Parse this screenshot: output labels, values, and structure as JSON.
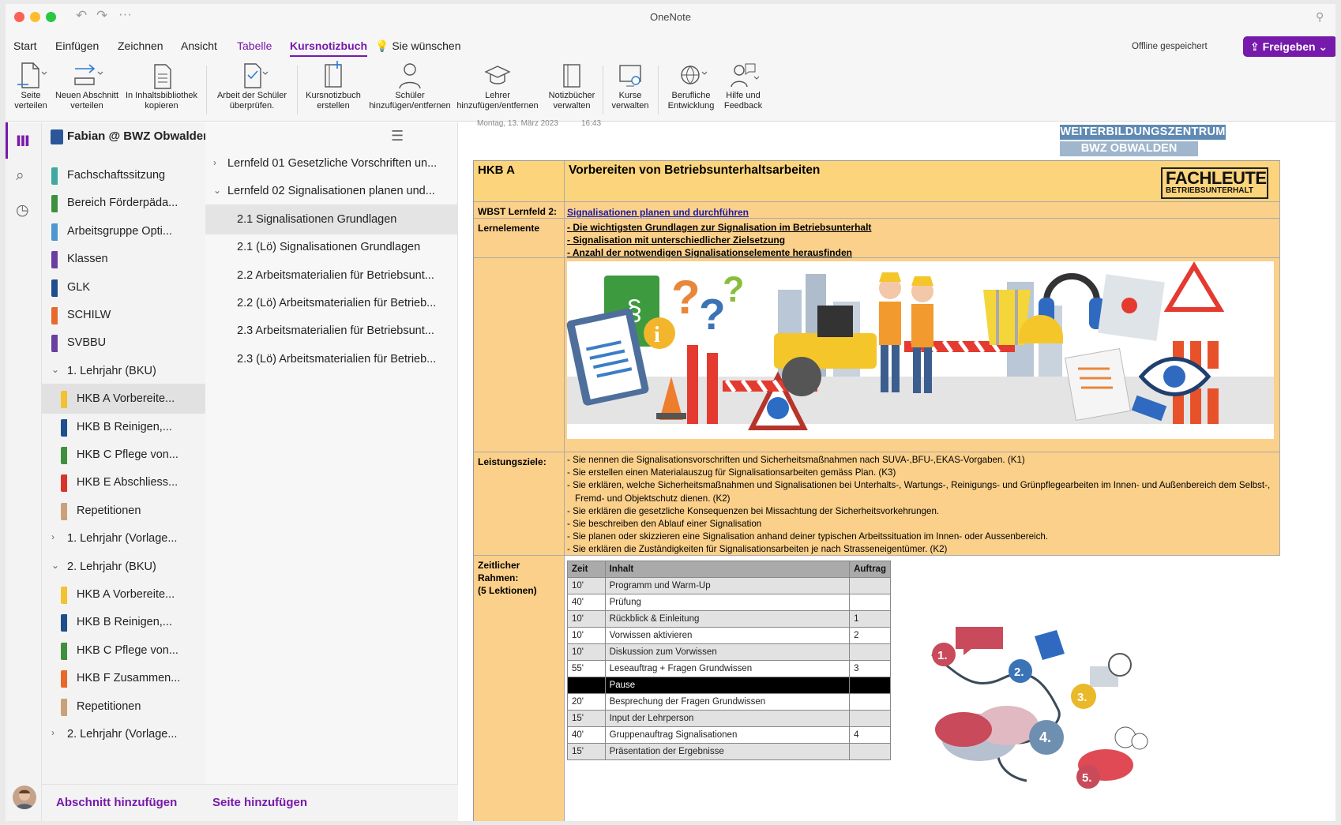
{
  "window": {
    "title": "OneNote"
  },
  "menu": {
    "tabs": [
      "Start",
      "Einfügen",
      "Zeichnen",
      "Ansicht",
      "Tabelle",
      "Kursnotizbuch"
    ],
    "tell_me": "Sie wünschen",
    "status": "Offline gespeichert",
    "share": "Freigeben"
  },
  "ribbon": {
    "buttons": [
      "Seite\nverteilen",
      "Neuen Abschnitt\nverteilen",
      "In Inhaltsbibliothek\nkopieren",
      "Arbeit der Schüler\nüberprüfen.",
      "Kursnotizbuch\nerstellen",
      "Schüler\nhinzufügen/entfernen",
      "Lehrer\nhinzufügen/entfernen",
      "Notizbücher\nverwalten",
      "Kurse\nverwalten",
      "Berufliche\nEntwicklung",
      "Hilfe und\nFeedback"
    ]
  },
  "notebook": {
    "name": "Fabian @ BWZ Obwalden"
  },
  "sections": [
    "Fachschaftssitzung",
    "Bereich Förderpäda...",
    "Arbeitsgruppe Opti...",
    "Klassen",
    "GLK",
    "SCHILW",
    "SVBBU",
    "1. Lehrjahr (BKU)",
    "HKB A Vorbereite...",
    "HKB B Reinigen,...",
    "HKB C Pflege von...",
    "HKB E Abschliess...",
    "Repetitionen",
    "1. Lehrjahr (Vorlage...",
    "2. Lehrjahr (BKU)",
    "HKB A Vorbereite...",
    "HKB B Reinigen,...",
    "HKB C Pflege von...",
    "HKB F Zusammen...",
    "Repetitionen",
    "2. Lehrjahr (Vorlage..."
  ],
  "pages": [
    "Lernfeld 01 Gesetzliche Vorschriften un...",
    "Lernfeld 02 Signalisationen planen und...",
    "2.1 Signalisationen Grundlagen",
    "2.1 (Lö) Signalisationen Grundlagen",
    "2.2 Arbeitsmaterialien für Betriebsunt...",
    "2.2 (Lö) Arbeitsmaterialien für Betrieb...",
    "2.3 Arbeitsmaterialien für Betriebsunt...",
    "2.3 (Lö) Arbeitsmaterialien für Betrieb..."
  ],
  "bottom": {
    "add_section": "Abschnitt hinzufügen",
    "add_page": "Seite hinzufügen"
  },
  "page": {
    "date": "Montag, 13. März 2023",
    "time": "16:43",
    "header_banner": [
      "WEITERBILDUNGSZENTRUM",
      "BWZ OBWALDEN"
    ],
    "hkb": "HKB A",
    "title": "Vorbereiten von Betriebsunterhaltsarbeiten",
    "badge": {
      "l1": "FACHLEUTE",
      "l2": "BETRIEBSUNTERHALT"
    },
    "wbst_label": "WBST Lernfeld 2:",
    "wbst_link": "Signalisationen planen und durchführen",
    "lernelemente_label": "Lernelemente",
    "lernelemente": [
      "Die wichtigsten Grundlagen zur Signalisation im Betriebsunterhalt",
      "Signalisation mit unterschiedlicher Zielsetzung",
      "Anzahl der notwendigen Signalisationselemente herausfinden"
    ],
    "leistungsziele_label": "Leistungsziele:",
    "leistungsziele": [
      "Sie nennen die Signalisationsvorschriften und Sicherheitsmaßnahmen nach SUVA-,BFU-,EKAS-Vorgaben. (K1)",
      "Sie erstellen einen Materialauszug für Signalisationsarbeiten gemäss Plan. (K3)",
      "Sie erklären, welche Sicherheitsmaßnahmen und Signalisationen bei Unterhalts-, Wartungs-, Reinigungs- und Grünpflegearbeiten im Innen- und Außenbereich dem Selbst-, Fremd- und Objektschutz dienen. (K2)",
      "Sie erklären die gesetzliche Konsequenzen bei Missachtung der Sicherheitsvorkehrungen.",
      "Sie beschreiben den Ablauf einer Signalisation",
      "Sie planen oder skizzieren eine Signalisation anhand deiner typischen Arbeitssituation im Innen- oder Aussenbereich.",
      "Sie erklären die Zuständigkeiten für Signalisationsarbeiten je nach Strasseneigentümer. (K2)"
    ],
    "zeit_label": "Zeitlicher\nRahmen:\n(5 Lektionen)",
    "schedule_headers": [
      "Zeit",
      "Inhalt",
      "Auftrag"
    ],
    "schedule": [
      [
        "10'",
        "Programm und Warm-Up",
        ""
      ],
      [
        "40'",
        "Prüfung",
        ""
      ],
      [
        "10'",
        "Rückblick & Einleitung",
        "1"
      ],
      [
        "10'",
        "Vorwissen aktivieren",
        "2"
      ],
      [
        "10'",
        "Diskussion zum Vorwissen",
        ""
      ],
      [
        "55'",
        "Leseauftrag + Fragen Grundwissen",
        "3"
      ],
      [
        "",
        "Pause",
        ""
      ],
      [
        "20'",
        "Besprechung der Fragen Grundwissen",
        ""
      ],
      [
        "15'",
        "Input der Lehrperson",
        ""
      ],
      [
        "40'",
        "Gruppenauftrag Signalisationen",
        "4"
      ],
      [
        "15'",
        "Präsentation der Ergebnisse",
        ""
      ]
    ],
    "steps": [
      "1.",
      "2.",
      "3.",
      "4.",
      "5."
    ]
  },
  "colors": {
    "accent": "#7719aa",
    "cell": "#fbd47c",
    "banner": "#5f8ab3"
  }
}
